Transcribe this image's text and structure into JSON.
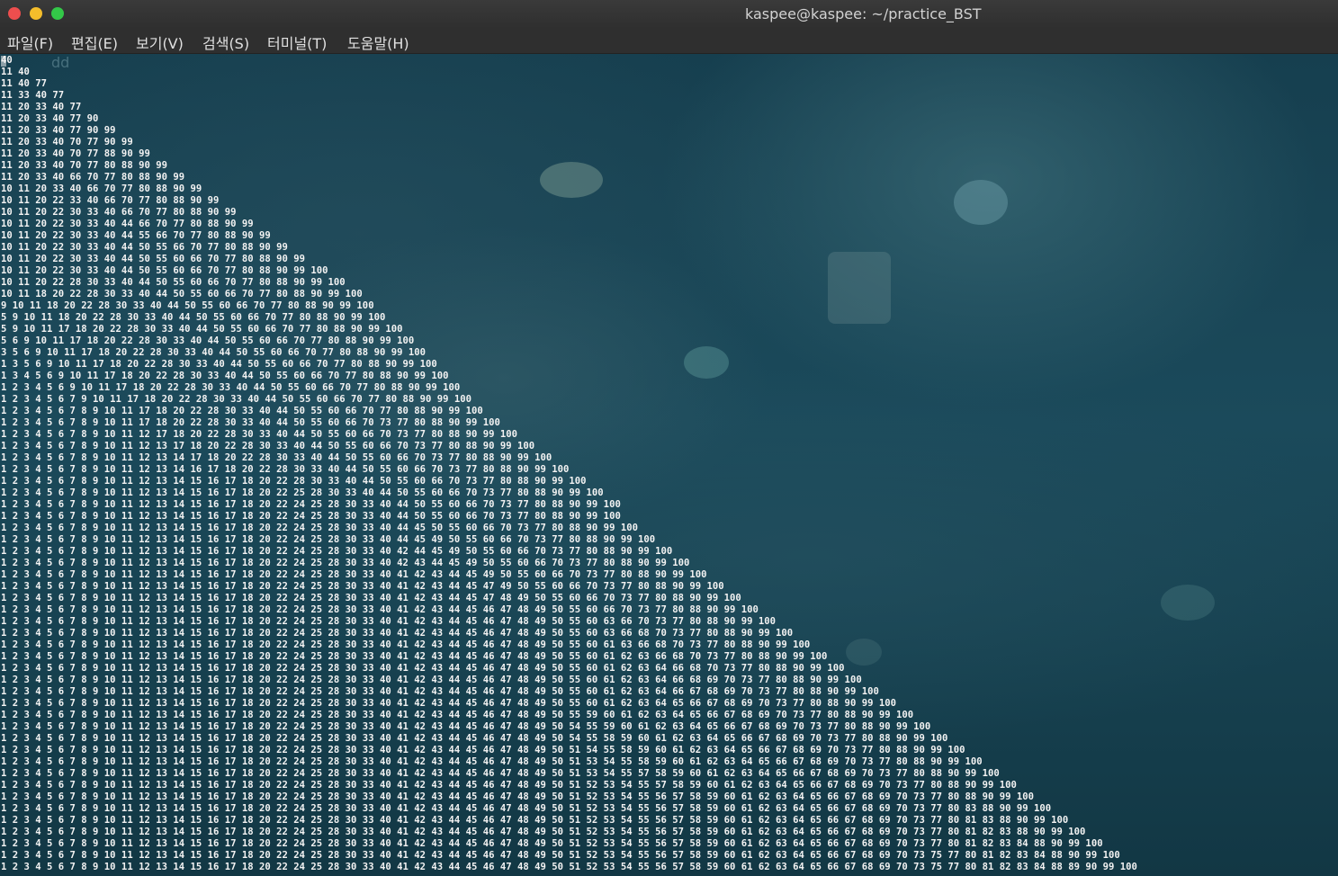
{
  "window": {
    "title": "kaspee@kaspee: ~/practice_BST"
  },
  "menu": [
    {
      "label": "파일(F)"
    },
    {
      "label": "편집(E)"
    },
    {
      "label": "보기(V)"
    },
    {
      "label": "검색(S)"
    },
    {
      "label": "터미널(T)"
    },
    {
      "label": "도움말(H)"
    }
  ],
  "terminal": {
    "ghost_text": "dd",
    "lines": [
      "40",
      "11 40",
      "11 40 77",
      "11 33 40 77",
      "11 20 33 40 77",
      "11 20 33 40 77 90",
      "11 20 33 40 77 90 99",
      "11 20 33 40 70 77 90 99",
      "11 20 33 40 70 77 88 90 99",
      "11 20 33 40 70 77 80 88 90 99",
      "11 20 33 40 66 70 77 80 88 90 99",
      "10 11 20 33 40 66 70 77 80 88 90 99",
      "10 11 20 22 33 40 66 70 77 80 88 90 99",
      "10 11 20 22 30 33 40 66 70 77 80 88 90 99",
      "10 11 20 22 30 33 40 44 66 70 77 80 88 90 99",
      "10 11 20 22 30 33 40 44 55 66 70 77 80 88 90 99",
      "10 11 20 22 30 33 40 44 50 55 66 70 77 80 88 90 99",
      "10 11 20 22 30 33 40 44 50 55 60 66 70 77 80 88 90 99",
      "10 11 20 22 30 33 40 44 50 55 60 66 70 77 80 88 90 99 100",
      "10 11 20 22 28 30 33 40 44 50 55 60 66 70 77 80 88 90 99 100",
      "10 11 18 20 22 28 30 33 40 44 50 55 60 66 70 77 80 88 90 99 100",
      "9 10 11 18 20 22 28 30 33 40 44 50 55 60 66 70 77 80 88 90 99 100",
      "5 9 10 11 18 20 22 28 30 33 40 44 50 55 60 66 70 77 80 88 90 99 100",
      "5 9 10 11 17 18 20 22 28 30 33 40 44 50 55 60 66 70 77 80 88 90 99 100",
      "5 6 9 10 11 17 18 20 22 28 30 33 40 44 50 55 60 66 70 77 80 88 90 99 100",
      "3 5 6 9 10 11 17 18 20 22 28 30 33 40 44 50 55 60 66 70 77 80 88 90 99 100",
      "1 3 5 6 9 10 11 17 18 20 22 28 30 33 40 44 50 55 60 66 70 77 80 88 90 99 100",
      "1 3 4 5 6 9 10 11 17 18 20 22 28 30 33 40 44 50 55 60 66 70 77 80 88 90 99 100",
      "1 2 3 4 5 6 9 10 11 17 18 20 22 28 30 33 40 44 50 55 60 66 70 77 80 88 90 99 100",
      "1 2 3 4 5 6 7 9 10 11 17 18 20 22 28 30 33 40 44 50 55 60 66 70 77 80 88 90 99 100",
      "1 2 3 4 5 6 7 8 9 10 11 17 18 20 22 28 30 33 40 44 50 55 60 66 70 77 80 88 90 99 100",
      "1 2 3 4 5 6 7 8 9 10 11 17 18 20 22 28 30 33 40 44 50 55 60 66 70 73 77 80 88 90 99 100",
      "1 2 3 4 5 6 7 8 9 10 11 12 17 18 20 22 28 30 33 40 44 50 55 60 66 70 73 77 80 88 90 99 100",
      "1 2 3 4 5 6 7 8 9 10 11 12 13 17 18 20 22 28 30 33 40 44 50 55 60 66 70 73 77 80 88 90 99 100",
      "1 2 3 4 5 6 7 8 9 10 11 12 13 14 17 18 20 22 28 30 33 40 44 50 55 60 66 70 73 77 80 88 90 99 100",
      "1 2 3 4 5 6 7 8 9 10 11 12 13 14 16 17 18 20 22 28 30 33 40 44 50 55 60 66 70 73 77 80 88 90 99 100",
      "1 2 3 4 5 6 7 8 9 10 11 12 13 14 15 16 17 18 20 22 28 30 33 40 44 50 55 60 66 70 73 77 80 88 90 99 100",
      "1 2 3 4 5 6 7 8 9 10 11 12 13 14 15 16 17 18 20 22 25 28 30 33 40 44 50 55 60 66 70 73 77 80 88 90 99 100",
      "1 2 3 4 5 6 7 8 9 10 11 12 13 14 15 16 17 18 20 22 24 25 28 30 33 40 44 50 55 60 66 70 73 77 80 88 90 99 100",
      "1 2 3 4 5 6 7 8 9 10 11 12 13 14 15 16 17 18 20 22 24 25 28 30 33 40 44 50 55 60 66 70 73 77 80 88 90 99 100",
      "1 2 3 4 5 6 7 8 9 10 11 12 13 14 15 16 17 18 20 22 24 25 28 30 33 40 44 45 50 55 60 66 70 73 77 80 88 90 99 100",
      "1 2 3 4 5 6 7 8 9 10 11 12 13 14 15 16 17 18 20 22 24 25 28 30 33 40 44 45 49 50 55 60 66 70 73 77 80 88 90 99 100",
      "1 2 3 4 5 6 7 8 9 10 11 12 13 14 15 16 17 18 20 22 24 25 28 30 33 40 42 44 45 49 50 55 60 66 70 73 77 80 88 90 99 100",
      "1 2 3 4 5 6 7 8 9 10 11 12 13 14 15 16 17 18 20 22 24 25 28 30 33 40 42 43 44 45 49 50 55 60 66 70 73 77 80 88 90 99 100",
      "1 2 3 4 5 6 7 8 9 10 11 12 13 14 15 16 17 18 20 22 24 25 28 30 33 40 41 42 43 44 45 49 50 55 60 66 70 73 77 80 88 90 99 100",
      "1 2 3 4 5 6 7 8 9 10 11 12 13 14 15 16 17 18 20 22 24 25 28 30 33 40 41 42 43 44 45 47 49 50 55 60 66 70 73 77 80 88 90 99 100",
      "1 2 3 4 5 6 7 8 9 10 11 12 13 14 15 16 17 18 20 22 24 25 28 30 33 40 41 42 43 44 45 47 48 49 50 55 60 66 70 73 77 80 88 90 99 100",
      "1 2 3 4 5 6 7 8 9 10 11 12 13 14 15 16 17 18 20 22 24 25 28 30 33 40 41 42 43 44 45 46 47 48 49 50 55 60 66 70 73 77 80 88 90 99 100",
      "1 2 3 4 5 6 7 8 9 10 11 12 13 14 15 16 17 18 20 22 24 25 28 30 33 40 41 42 43 44 45 46 47 48 49 50 55 60 63 66 70 73 77 80 88 90 99 100",
      "1 2 3 4 5 6 7 8 9 10 11 12 13 14 15 16 17 18 20 22 24 25 28 30 33 40 41 42 43 44 45 46 47 48 49 50 55 60 63 66 68 70 73 77 80 88 90 99 100",
      "1 2 3 4 5 6 7 8 9 10 11 12 13 14 15 16 17 18 20 22 24 25 28 30 33 40 41 42 43 44 45 46 47 48 49 50 55 60 61 63 66 68 70 73 77 80 88 90 99 100",
      "1 2 3 4 5 6 7 8 9 10 11 12 13 14 15 16 17 18 20 22 24 25 28 30 33 40 41 42 43 44 45 46 47 48 49 50 55 60 61 62 63 66 68 70 73 77 80 88 90 99 100",
      "1 2 3 4 5 6 7 8 9 10 11 12 13 14 15 16 17 18 20 22 24 25 28 30 33 40 41 42 43 44 45 46 47 48 49 50 55 60 61 62 63 64 66 68 70 73 77 80 88 90 99 100",
      "1 2 3 4 5 6 7 8 9 10 11 12 13 14 15 16 17 18 20 22 24 25 28 30 33 40 41 42 43 44 45 46 47 48 49 50 55 60 61 62 63 64 66 68 69 70 73 77 80 88 90 99 100",
      "1 2 3 4 5 6 7 8 9 10 11 12 13 14 15 16 17 18 20 22 24 25 28 30 33 40 41 42 43 44 45 46 47 48 49 50 55 60 61 62 63 64 66 67 68 69 70 73 77 80 88 90 99 100",
      "1 2 3 4 5 6 7 8 9 10 11 12 13 14 15 16 17 18 20 22 24 25 28 30 33 40 41 42 43 44 45 46 47 48 49 50 55 60 61 62 63 64 65 66 67 68 69 70 73 77 80 88 90 99 100",
      "1 2 3 4 5 6 7 8 9 10 11 12 13 14 15 16 17 18 20 22 24 25 28 30 33 40 41 42 43 44 45 46 47 48 49 50 55 59 60 61 62 63 64 65 66 67 68 69 70 73 77 80 88 90 99 100",
      "1 2 3 4 5 6 7 8 9 10 11 12 13 14 15 16 17 18 20 22 24 25 28 30 33 40 41 42 43 44 45 46 47 48 49 50 54 55 59 60 61 62 63 64 65 66 67 68 69 70 73 77 80 88 90 99 100",
      "1 2 3 4 5 6 7 8 9 10 11 12 13 14 15 16 17 18 20 22 24 25 28 30 33 40 41 42 43 44 45 46 47 48 49 50 54 55 58 59 60 61 62 63 64 65 66 67 68 69 70 73 77 80 88 90 99 100",
      "1 2 3 4 5 6 7 8 9 10 11 12 13 14 15 16 17 18 20 22 24 25 28 30 33 40 41 42 43 44 45 46 47 48 49 50 51 54 55 58 59 60 61 62 63 64 65 66 67 68 69 70 73 77 80 88 90 99 100",
      "1 2 3 4 5 6 7 8 9 10 11 12 13 14 15 16 17 18 20 22 24 25 28 30 33 40 41 42 43 44 45 46 47 48 49 50 51 53 54 55 58 59 60 61 62 63 64 65 66 67 68 69 70 73 77 80 88 90 99 100",
      "1 2 3 4 5 6 7 8 9 10 11 12 13 14 15 16 17 18 20 22 24 25 28 30 33 40 41 42 43 44 45 46 47 48 49 50 51 53 54 55 57 58 59 60 61 62 63 64 65 66 67 68 69 70 73 77 80 88 90 99 100",
      "1 2 3 4 5 6 7 8 9 10 11 12 13 14 15 16 17 18 20 22 24 25 28 30 33 40 41 42 43 44 45 46 47 48 49 50 51 52 53 54 55 57 58 59 60 61 62 63 64 65 66 67 68 69 70 73 77 80 88 90 99 100",
      "1 2 3 4 5 6 7 8 9 10 11 12 13 14 15 16 17 18 20 22 24 25 28 30 33 40 41 42 43 44 45 46 47 48 49 50 51 52 53 54 55 56 57 58 59 60 61 62 63 64 65 66 67 68 69 70 73 77 80 88 90 99 100",
      "1 2 3 4 5 6 7 8 9 10 11 12 13 14 15 16 17 18 20 22 24 25 28 30 33 40 41 42 43 44 45 46 47 48 49 50 51 52 53 54 55 56 57 58 59 60 61 62 63 64 65 66 67 68 69 70 73 77 80 83 88 90 99 100",
      "1 2 3 4 5 6 7 8 9 10 11 12 13 14 15 16 17 18 20 22 24 25 28 30 33 40 41 42 43 44 45 46 47 48 49 50 51 52 53 54 55 56 57 58 59 60 61 62 63 64 65 66 67 68 69 70 73 77 80 81 83 88 90 99 100",
      "1 2 3 4 5 6 7 8 9 10 11 12 13 14 15 16 17 18 20 22 24 25 28 30 33 40 41 42 43 44 45 46 47 48 49 50 51 52 53 54 55 56 57 58 59 60 61 62 63 64 65 66 67 68 69 70 73 77 80 81 82 83 88 90 99 100",
      "1 2 3 4 5 6 7 8 9 10 11 12 13 14 15 16 17 18 20 22 24 25 28 30 33 40 41 42 43 44 45 46 47 48 49 50 51 52 53 54 55 56 57 58 59 60 61 62 63 64 65 66 67 68 69 70 73 77 80 81 82 83 84 88 90 99 100",
      "1 2 3 4 5 6 7 8 9 10 11 12 13 14 15 16 17 18 20 22 24 25 28 30 33 40 41 42 43 44 45 46 47 48 49 50 51 52 53 54 55 56 57 58 59 60 61 62 63 64 65 66 67 68 69 70 73 75 77 80 81 82 83 84 88 90 99 100",
      "1 2 3 4 5 6 7 8 9 10 11 12 13 14 15 16 17 18 20 22 24 25 28 30 33 40 41 42 43 44 45 46 47 48 49 50 51 52 53 54 55 56 57 58 59 60 61 62 63 64 65 66 67 68 69 70 73 75 77 80 81 82 83 84 88 89 90 99 100"
    ]
  }
}
